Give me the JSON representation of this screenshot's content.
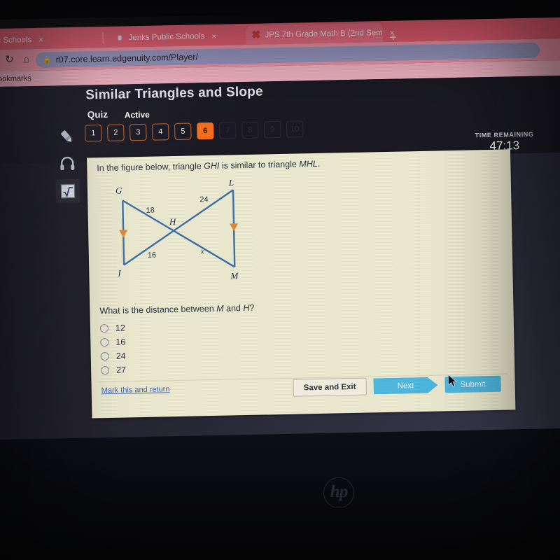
{
  "browser": {
    "tabs": [
      {
        "title": "nks Public Schools",
        "favicon": "globe-icon",
        "active": false
      },
      {
        "title": "Jenks Public Schools",
        "favicon": "jenks-icon",
        "active": false
      },
      {
        "title": "JPS 7th Grade Math B (2nd Sem",
        "favicon": "red-x-icon",
        "active": true
      }
    ],
    "new_tab_label": "+",
    "close_label": "×",
    "reload_icon": "reload-icon",
    "home_icon": "home-icon",
    "lock_icon": "lock-icon",
    "url": "r07.core.learn.edgenuity.com/Player/",
    "bookmarks_label": "Bookmarks"
  },
  "app": {
    "course_title": "Similar Triangles and Slope",
    "quiz_label": "Quiz",
    "quiz_state": "Active",
    "timer": {
      "label": "TIME REMAINING",
      "value": "47:13"
    },
    "question_numbers": [
      {
        "n": "1",
        "state": "available"
      },
      {
        "n": "2",
        "state": "available"
      },
      {
        "n": "3",
        "state": "available"
      },
      {
        "n": "4",
        "state": "available"
      },
      {
        "n": "5",
        "state": "available"
      },
      {
        "n": "6",
        "state": "current"
      },
      {
        "n": "7",
        "state": "locked"
      },
      {
        "n": "8",
        "state": "locked"
      },
      {
        "n": "9",
        "state": "locked"
      },
      {
        "n": "10",
        "state": "locked"
      }
    ],
    "tools": [
      {
        "name": "highlighter-tool",
        "icon": "pencil-icon",
        "active": false
      },
      {
        "name": "audio-tool",
        "icon": "headphones-icon",
        "active": false
      },
      {
        "name": "calculator-tool",
        "icon": "sqrt-x-icon",
        "active": true
      }
    ]
  },
  "question": {
    "stem_before": "In the figure below, triangle ",
    "stem_italic_1": "GHI",
    "stem_middle": " is similar to triangle ",
    "stem_italic_2": "MHL",
    "stem_after": ".",
    "prompt_before": "What is the distance between ",
    "prompt_italic_1": "M",
    "prompt_middle": " and ",
    "prompt_italic_2": "H",
    "prompt_after": "?",
    "options": [
      {
        "value": "12",
        "selected": false
      },
      {
        "value": "16",
        "selected": false
      },
      {
        "value": "24",
        "selected": false
      },
      {
        "value": "27",
        "selected": false
      }
    ]
  },
  "figure": {
    "description": "Two similar triangles meeting at point H forming a bowtie",
    "vertices": [
      "G",
      "H",
      "I",
      "L",
      "M"
    ],
    "labels": {
      "G": "G",
      "H": "H",
      "I": "I",
      "L": "L",
      "M": "M"
    },
    "side_labels": {
      "GH": "18",
      "IH": "16",
      "HL": "24",
      "HM": "x"
    },
    "line_color": "#3d6fa8",
    "arrow_color": "#e08a34"
  },
  "footer": {
    "mark_link": "Mark this and return",
    "save_and_exit": "Save and Exit",
    "next": "Next",
    "submit": "Submit"
  },
  "hardware": {
    "brand_logo": "hp"
  },
  "colors": {
    "accent_orange": "#f3701d",
    "button_blue": "#4fb8de",
    "card_bg": "#ecead0",
    "figure_blue": "#3d6fa8"
  }
}
